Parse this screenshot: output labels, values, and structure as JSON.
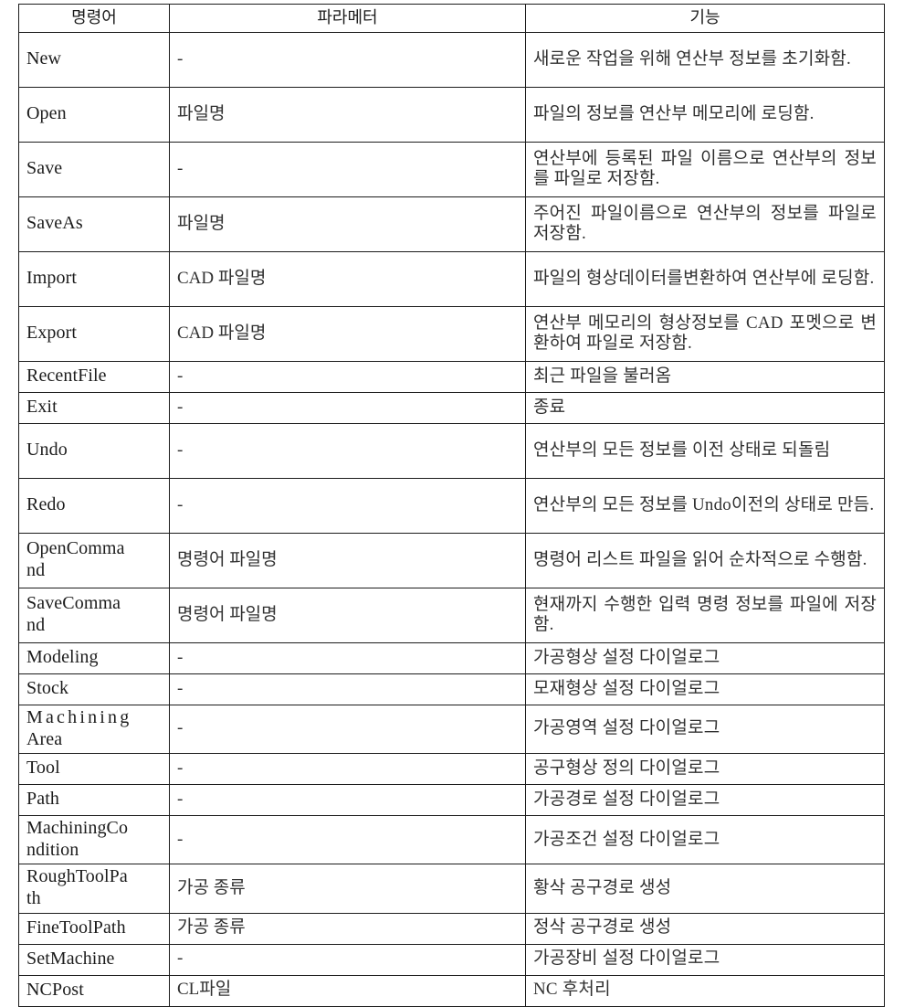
{
  "table": {
    "headers": {
      "command": "명령어",
      "parameter": "파라메터",
      "function": "기능"
    },
    "rows": [
      {
        "command": "New",
        "parameter": "-",
        "function": "새로운 작업을 위해 연산부 정보를 초기화함."
      },
      {
        "command": "Open",
        "parameter": "파일명",
        "function": "파일의 정보를 연산부 메모리에 로딩함."
      },
      {
        "command": "Save",
        "parameter": "-",
        "function": "연산부에 등록된 파일 이름으로 연산부의 정보를 파일로 저장함."
      },
      {
        "command": "SaveAs",
        "parameter": "파일명",
        "function": "주어진 파일이름으로 연산부의 정보를 파일로 저장함."
      },
      {
        "command": "Import",
        "parameter": "CAD 파일명",
        "function": "파일의 형상데이터를변환하여 연산부에 로딩함."
      },
      {
        "command": "Export",
        "parameter": "CAD 파일명",
        "function": "연산부 메모리의 형상정보를 CAD 포멧으로 변환하여 파일로 저장함."
      },
      {
        "command": "RecentFile",
        "parameter": "-",
        "function": "최근 파일을 불러옴"
      },
      {
        "command": "Exit",
        "parameter": "-",
        "function": "종료"
      },
      {
        "command": "Undo",
        "parameter": "-",
        "function": "연산부의 모든 정보를 이전 상태로 되돌림"
      },
      {
        "command": "Redo",
        "parameter": "-",
        "function": "연산부의 모든 정보를 Undo이전의 상태로 만듬."
      },
      {
        "command": "OpenCommand",
        "parameter": "명령어 파일명",
        "function": "명령어 리스트 파일을 읽어 순차적으로 수행함."
      },
      {
        "command": "SaveCommand",
        "parameter": "명령어 파일명",
        "function": "현재까지 수행한 입력 명령 정보를 파일에 저장함."
      },
      {
        "command": "Modeling",
        "parameter": "-",
        "function": "가공형상 설정 다이얼로그"
      },
      {
        "command": "Stock",
        "parameter": "-",
        "function": "모재형상 설정 다이얼로그"
      },
      {
        "command": "MachiningArea",
        "parameter": "-",
        "function": "가공영역 설정 다이얼로그"
      },
      {
        "command": "Tool",
        "parameter": "-",
        "function": "공구형상 정의 다이얼로그"
      },
      {
        "command": "Path",
        "parameter": "-",
        "function": "가공경로 설정 다이얼로그"
      },
      {
        "command": "MachiningCondition",
        "parameter": "-",
        "function": "가공조건 설정 다이얼로그"
      },
      {
        "command": "RoughToolPath",
        "parameter": "가공 종류",
        "function": "황삭 공구경로 생성"
      },
      {
        "command": "FineToolPath",
        "parameter": "가공 종류",
        "function": "정삭 공구경로 생성"
      },
      {
        "command": "SetMachine",
        "parameter": "-",
        "function": "가공장비 설정 다이얼로그"
      },
      {
        "command": "NCPost",
        "parameter": "CL파일",
        "function": "NC 후처리"
      }
    ],
    "row_styles": [
      "tall",
      "tall",
      "tall",
      "tall",
      "tall",
      "tall",
      "short",
      "short",
      "tall",
      "tall",
      "tall",
      "tall",
      "short",
      "short",
      "med",
      "short",
      "short",
      "med",
      "med",
      "short",
      "short",
      "short"
    ],
    "name_wraps": {
      "MachiningArea": [
        "Machining",
        "Area"
      ],
      "MachiningCondition": [
        "MachiningCo",
        "ndition"
      ],
      "OpenCommand": [
        "OpenComma",
        "nd"
      ],
      "SaveCommand": [
        "SaveComma",
        "nd"
      ],
      "RoughToolPath": [
        "RoughToolPa",
        "th"
      ]
    }
  }
}
